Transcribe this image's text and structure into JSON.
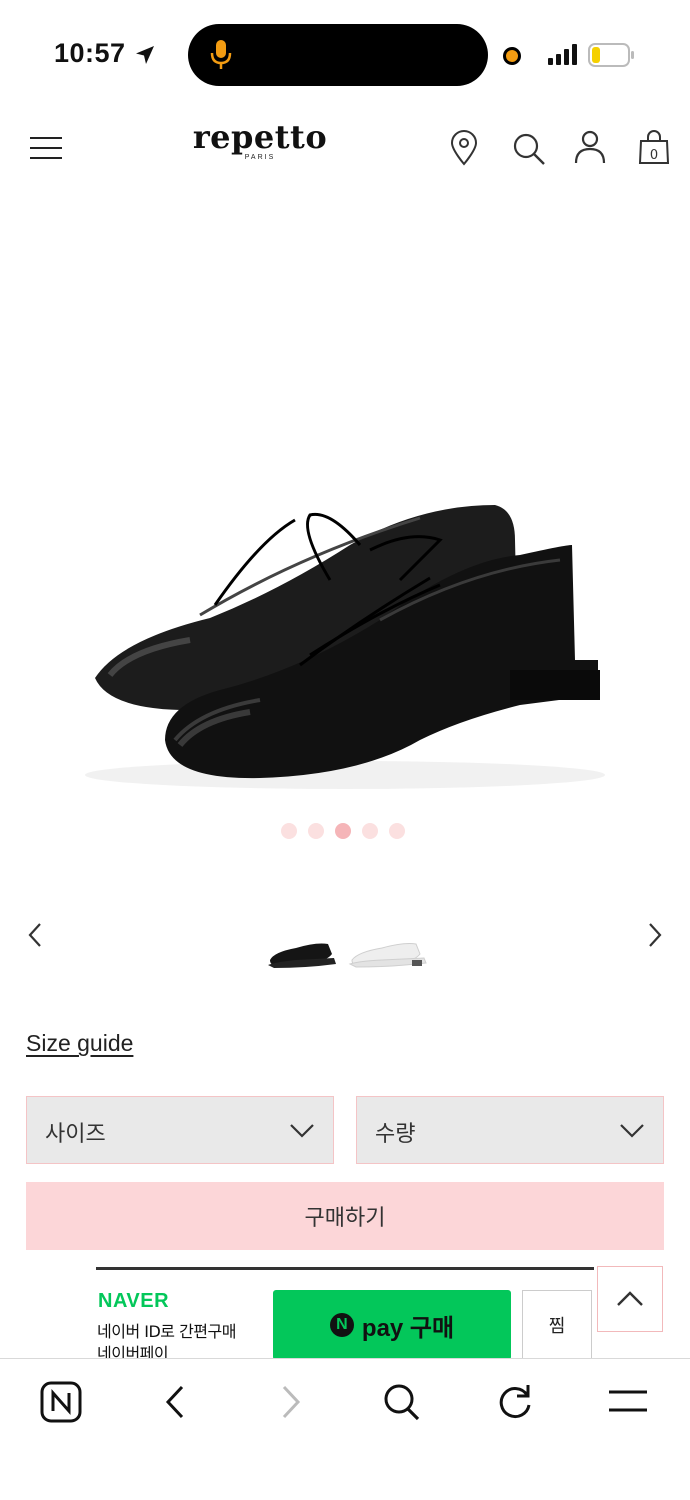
{
  "status_bar": {
    "time": "10:57"
  },
  "header": {
    "brand": "repetto",
    "brand_sub": "PARIS"
  },
  "gallery": {
    "dots_total": 5,
    "active_dot": 3
  },
  "product": {
    "size_guide": "Size guide",
    "size_select": "사이즈",
    "qty_select": "수량",
    "buy_button": "구매하기"
  },
  "naver": {
    "logo": "NAVER",
    "line1": "네이버 ID로 간편구매",
    "line2": "네이버페이",
    "npay_n": "N",
    "npay_label": "pay 구매",
    "zzim": "찜"
  },
  "colors": {
    "accent_pink": "#fcd6d8",
    "naver_green": "#03c75a",
    "select_bg": "#e9e9e9"
  }
}
